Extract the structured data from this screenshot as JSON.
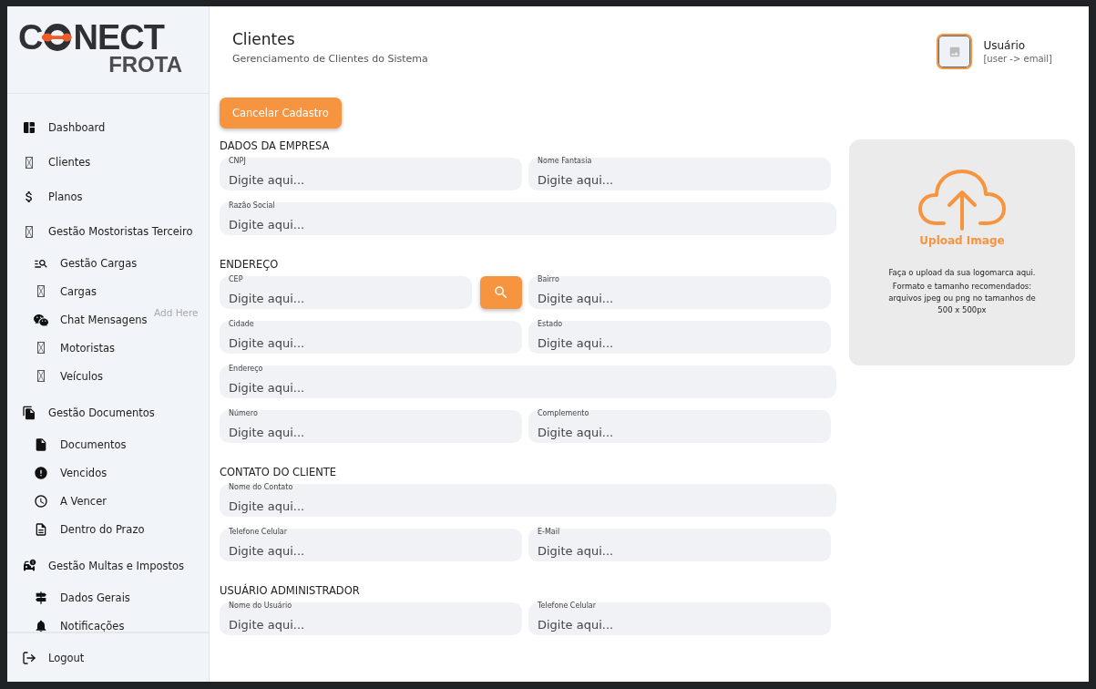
{
  "logo": {
    "lead": "C",
    "tail": "NECT",
    "sub": "FROTA"
  },
  "sidebar": {
    "items": [
      {
        "label": "Dashboard"
      },
      {
        "label": "Clientes"
      },
      {
        "label": "Planos"
      },
      {
        "label": "Gestão Mostoristas Terceiro",
        "children": [
          {
            "label": "Gestão Cargas"
          },
          {
            "label": "Cargas"
          },
          {
            "label": "Chat Mensagens",
            "note": "Add Here"
          },
          {
            "label": "Motoristas"
          },
          {
            "label": "Veículos"
          }
        ]
      },
      {
        "label": "Gestão Documentos",
        "children": [
          {
            "label": "Documentos"
          },
          {
            "label": "Vencidos"
          },
          {
            "label": "A Vencer"
          },
          {
            "label": "Dentro do Prazo"
          }
        ]
      },
      {
        "label": "Gestão Multas e Impostos",
        "children": [
          {
            "label": "Dados Gerais"
          },
          {
            "label": "Notificações"
          }
        ]
      }
    ],
    "logout": "Logout"
  },
  "header": {
    "title": "Clientes",
    "subtitle": "Gerenciamento de Clientes do Sistema",
    "user": {
      "name": "Usuário",
      "email": "[user -> email]"
    }
  },
  "form": {
    "cancel_button": "Cancelar Cadastro",
    "sections": [
      {
        "title": "DADOS DA EMPRESA",
        "rows": [
          [
            {
              "label": "CNPJ",
              "placeholder": "Digite aqui..."
            },
            {
              "label": "Nome Fantasia",
              "placeholder": "Digite aqui..."
            }
          ],
          [
            {
              "label": "Razão Social",
              "placeholder": "Digite aqui..."
            }
          ]
        ]
      },
      {
        "title": "ENDEREÇO",
        "rows": [
          [
            {
              "label": "CEP",
              "placeholder": "Digite aqui...",
              "search_button": true
            },
            {
              "label": "Bairro",
              "placeholder": "Digite aqui..."
            }
          ],
          [
            {
              "label": "Cidade",
              "placeholder": "Digite aqui..."
            },
            {
              "label": "Estado",
              "placeholder": "Digite aqui..."
            }
          ],
          [
            {
              "label": "Endereço",
              "placeholder": "Digite aqui..."
            }
          ],
          [
            {
              "label": "Número",
              "placeholder": "Digite aqui..."
            },
            {
              "label": "Complemento",
              "placeholder": "Digite aqui..."
            }
          ]
        ]
      },
      {
        "title": "CONTATO DO CLIENTE",
        "rows": [
          [
            {
              "label": "Nome do Contato",
              "placeholder": "Digite aqui..."
            }
          ],
          [
            {
              "label": "Telefone Celular",
              "placeholder": "Digite aqui..."
            },
            {
              "label": "E-Mail",
              "placeholder": "Digite aqui..."
            }
          ]
        ]
      },
      {
        "title": "USUÁRIO ADMINISTRADOR",
        "rows": [
          [
            {
              "label": "Nome do Usuário",
              "placeholder": "Digite aqui..."
            },
            {
              "label": "Telefone Celular",
              "placeholder": "Digite aqui..."
            }
          ]
        ]
      }
    ]
  },
  "upload": {
    "title": "Upload Image",
    "paragraphs": [
      "Faça o upload da sua logomarca aqui.",
      "Formato e tamanho recomendados: arquivos jpeg ou png no tamanhos de 500 x 500px"
    ]
  }
}
